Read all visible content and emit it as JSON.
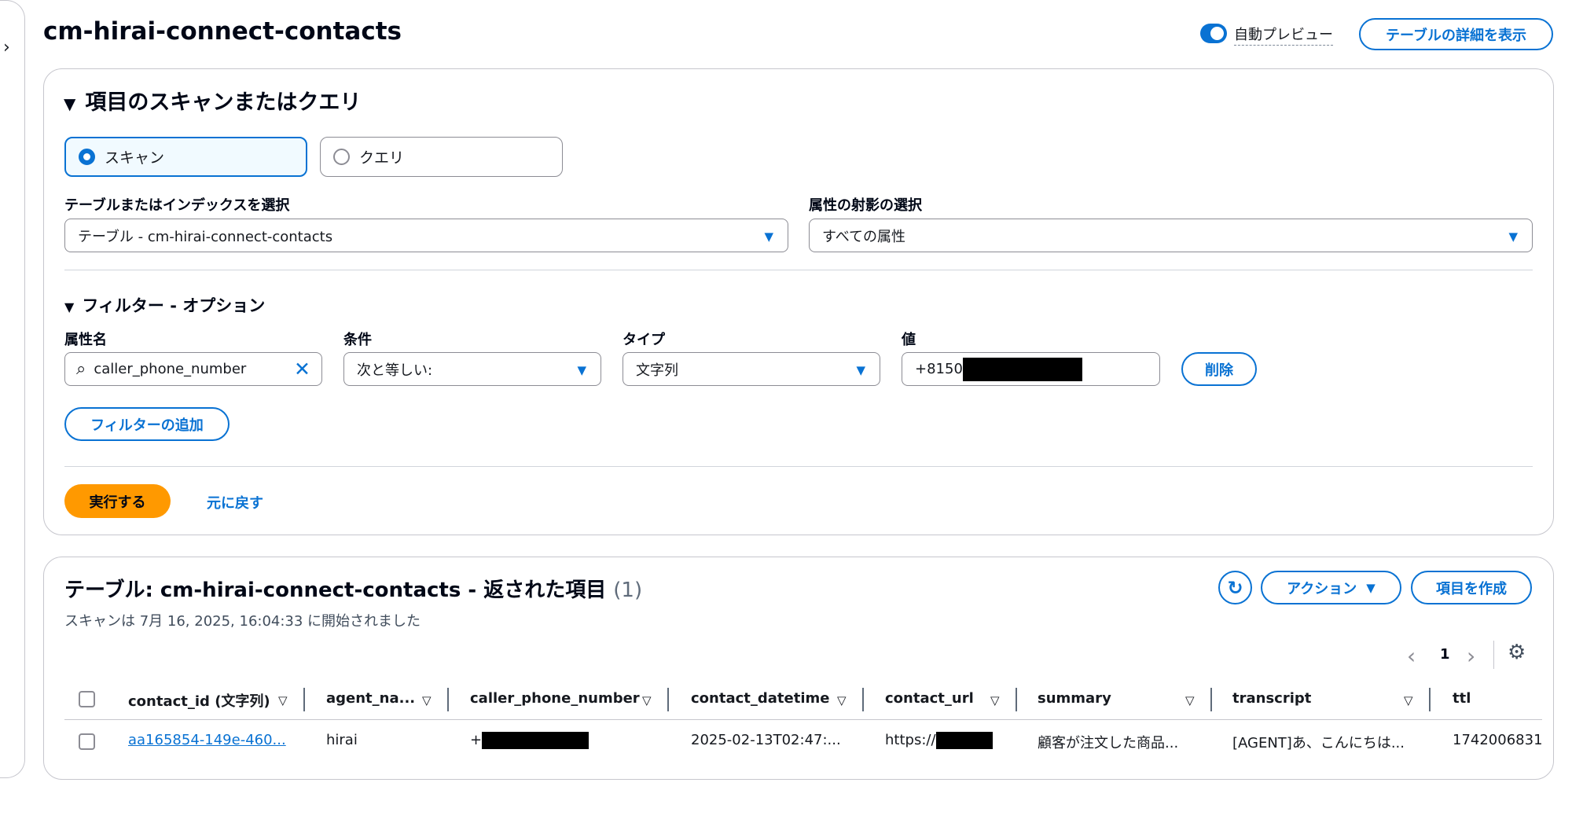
{
  "page": {
    "title": "cm-hirai-connect-contacts",
    "auto_preview_label": "自動プレビュー",
    "table_details_button": "テーブルの詳細を表示"
  },
  "scan_query": {
    "title": "項目のスキャンまたはクエリ",
    "scan_label": "スキャン",
    "query_label": "クエリ",
    "selected_mode": "スキャン",
    "table_index_label": "テーブルまたはインデックスを選択",
    "table_index_value": "テーブル - cm-hirai-connect-contacts",
    "projection_label": "属性の射影の選択",
    "projection_value": "すべての属性"
  },
  "filters": {
    "title": "フィルター - オプション",
    "attribute_label": "属性名",
    "attribute_value": "caller_phone_number",
    "condition_label": "条件",
    "condition_value": "次と等しい:",
    "type_label": "タイプ",
    "type_value": "文字列",
    "value_label": "値",
    "value_visible": "+8150",
    "remove_button": "削除",
    "add_filter_button": "フィルターの追加"
  },
  "actions": {
    "run_button": "実行する",
    "reset_link": "元に戻す"
  },
  "results": {
    "title": "テーブル: cm-hirai-connect-contacts - 返された項目",
    "count": "(1)",
    "scan_info": "スキャンは 7月 16, 2025, 16:04:33 に開始されました",
    "actions_button": "アクション",
    "create_item_button": "項目を作成",
    "page_number": "1"
  },
  "table": {
    "columns": [
      "contact_id (文字列)",
      "agent_na...",
      "caller_phone_number",
      "contact_datetime",
      "contact_url",
      "summary",
      "transcript",
      "ttl"
    ],
    "row": {
      "contact_id": "aa165854-149e-460...",
      "agent_name": "hirai",
      "caller_phone_number": "+",
      "contact_datetime": "2025-02-13T02:47:...",
      "contact_url": "https://",
      "summary": "顧客が注文した商品...",
      "transcript": "[AGENT]あ、こんにちは...",
      "ttl": "1742006831"
    }
  },
  "colors": {
    "primary": "#0972d3",
    "run_button": "#ff9900",
    "border": "#c6c6cd"
  },
  "icons": [
    "chevron-right-icon",
    "caret-down-icon",
    "search-icon",
    "close-icon",
    "refresh-icon",
    "chevron-left-icon",
    "gear-icon"
  ]
}
